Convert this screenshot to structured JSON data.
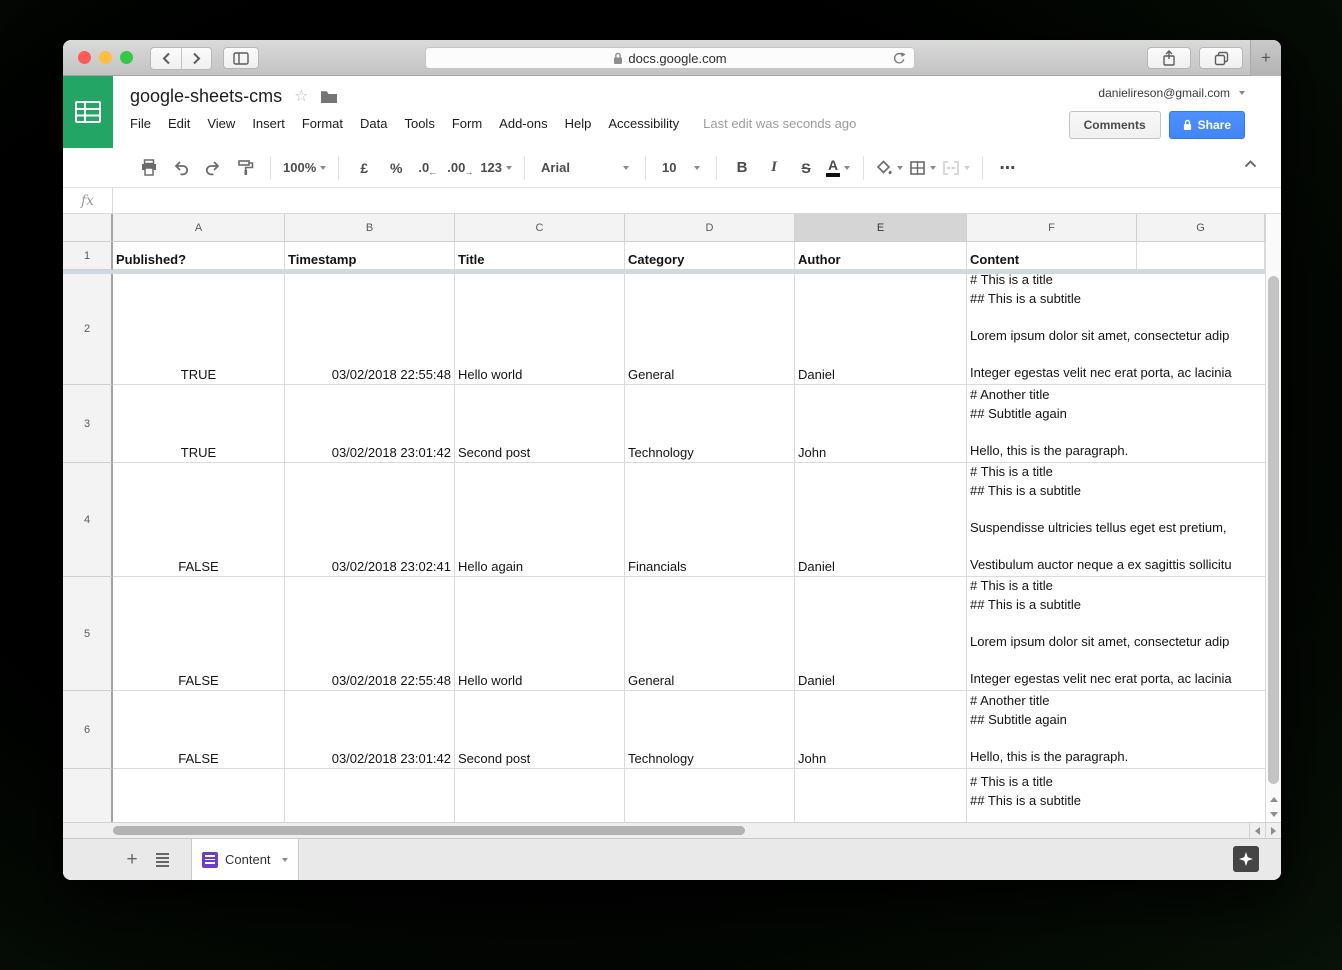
{
  "browser": {
    "url": "docs.google.com",
    "new_tab": "+"
  },
  "doc": {
    "title": "google-sheets-cms"
  },
  "menus": [
    "File",
    "Edit",
    "View",
    "Insert",
    "Format",
    "Data",
    "Tools",
    "Form",
    "Add-ons",
    "Help",
    "Accessibility"
  ],
  "header": {
    "last_edit": "Last edit was seconds ago",
    "email": "danielireson@gmail.com",
    "comments": "Comments",
    "share": "Share"
  },
  "toolbar": {
    "zoom": "100%",
    "currency": "£",
    "percent": "%",
    "decrease_decimal": ".0",
    "increase_decimal": ".00",
    "number_format": "123",
    "font": "Arial",
    "font_size": "10",
    "bold": "B",
    "italic": "I",
    "strikethrough": "S",
    "text_color": "A",
    "more": "⋯"
  },
  "formula": {
    "fx": "fx",
    "value": ""
  },
  "sheet": {
    "col_letters": [
      "A",
      "B",
      "C",
      "D",
      "E",
      "F",
      "G"
    ],
    "selected_col": "E",
    "header_row_num": "1",
    "headers": [
      "Published?",
      "Timestamp",
      "Title",
      "Category",
      "Author",
      "Content",
      ""
    ],
    "data_rows": [
      {
        "n": "2",
        "cells": [
          "TRUE",
          "03/02/2018 22:55:48",
          "Hello world",
          "General",
          "Daniel",
          "# This is a title\n## This is a subtitle\n\nLorem ipsum dolor sit amet, consectetur adip\n\nInteger egestas velit nec erat porta, ac lacinia"
        ]
      },
      {
        "n": "3",
        "cells": [
          "TRUE",
          "03/02/2018 23:01:42",
          "Second post",
          "Technology",
          "John",
          "# Another title\n## Subtitle again\n\nHello, this is the paragraph."
        ]
      },
      {
        "n": "4",
        "cells": [
          "FALSE",
          "03/02/2018 23:02:41",
          "Hello again",
          "Financials",
          "Daniel",
          "# This is a title\n## This is a subtitle\n\nSuspendisse ultricies tellus eget est pretium,\n\nVestibulum auctor neque a ex sagittis sollicitu"
        ]
      },
      {
        "n": "5",
        "cells": [
          "FALSE",
          "03/02/2018 22:55:48",
          "Hello world",
          "General",
          "Daniel",
          "# This is a title\n## This is a subtitle\n\nLorem ipsum dolor sit amet, consectetur adip\n\nInteger egestas velit nec erat porta, ac lacinia"
        ]
      },
      {
        "n": "6",
        "cells": [
          "FALSE",
          "03/02/2018 23:01:42",
          "Second post",
          "Technology",
          "John",
          "# Another title\n## Subtitle again\n\nHello, this is the paragraph."
        ]
      },
      {
        "n": "",
        "cells": [
          "",
          "",
          "",
          "",
          "",
          "# This is a title\n## This is a subtitle"
        ]
      }
    ]
  },
  "tabs": {
    "add": "+",
    "content_tab": "Content"
  },
  "colors": {
    "sheets_green": "#23a566",
    "share_blue": "#4285f4",
    "tab_purple": "#6742c9",
    "traffic_red": "#fc5b57",
    "traffic_yellow": "#fdbe41",
    "traffic_green": "#34c84a",
    "frozen_divider": "#cfd9e6"
  }
}
